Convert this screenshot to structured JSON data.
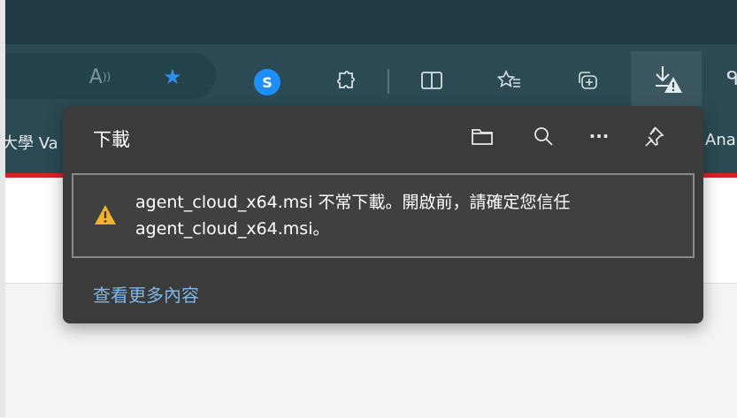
{
  "bookmarks": {
    "left_fragment": "大學 Va",
    "right_fragment": "Ana"
  },
  "toolbar": {
    "read_aloud_icon": "read-aloud-icon",
    "favorite_icon": "star-icon",
    "extension_icon": "shazam-icon",
    "extensions_icon": "puzzle-icon",
    "split_screen_icon": "split-screen-icon",
    "favorites_icon": "favorites-list-icon",
    "collections_icon": "collections-icon",
    "downloads_icon": "download-warning-icon"
  },
  "downloads_panel": {
    "title": "下載",
    "actions": [
      "folder-icon",
      "search-icon",
      "more-icon",
      "pin-icon"
    ],
    "item": {
      "line1": "agent_cloud_x64.msi 不常下載。開啟前，請確定您信任",
      "line2": "agent_cloud_x64.msi。"
    },
    "see_more": "查看更多內容"
  },
  "colors": {
    "accent": "#1e8ffa",
    "warning": "#f2b22d",
    "link": "#7fb6e8",
    "bookmark_bar_border": "#d6242b"
  }
}
